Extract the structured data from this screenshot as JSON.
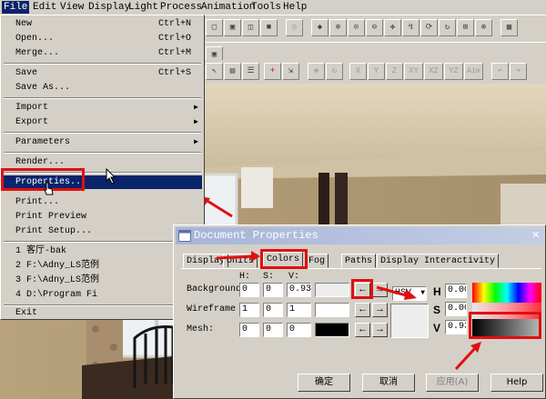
{
  "menubar": {
    "items": [
      "File",
      "Edit",
      "View",
      "Display",
      "Light",
      "Process",
      "Animation",
      "Tools",
      "Help"
    ]
  },
  "toolbar": {
    "axis_buttons": [
      "X",
      "Y",
      "Z",
      "XY",
      "XZ",
      "YZ",
      "Aim"
    ]
  },
  "file_menu": {
    "items": [
      {
        "label": "New",
        "shortcut": "Ctrl+N"
      },
      {
        "label": "Open...",
        "shortcut": "Ctrl+O"
      },
      {
        "label": "Merge...",
        "shortcut": "Ctrl+M"
      },
      {
        "label": "Save",
        "shortcut": "Ctrl+S"
      },
      {
        "label": "Save As..."
      },
      {
        "label": "Import"
      },
      {
        "label": "Export"
      },
      {
        "label": "Parameters"
      },
      {
        "label": "Render..."
      },
      {
        "label": "Properties..."
      },
      {
        "label": "Print..."
      },
      {
        "label": "Print Preview"
      },
      {
        "label": "Print Setup..."
      },
      {
        "label": "1 客厅-bak"
      },
      {
        "label": "2 F:\\Adny_LS范例"
      },
      {
        "label": "3 F:\\Adny_LS范例"
      },
      {
        "label": "4 D:\\Program Fi"
      },
      {
        "label": "Exit"
      }
    ]
  },
  "dialog": {
    "title": "Document Properties",
    "close_glyph": "×",
    "tabs": [
      "Display",
      "Units",
      "Colors",
      "Fog",
      "Paths",
      "Display Interactivity"
    ],
    "headers": {
      "h": "H:",
      "s": "S:",
      "v": "V:"
    },
    "rows": [
      {
        "label": "Background:",
        "h": "0",
        "s": "0",
        "v": "0.93"
      },
      {
        "label": "Wireframe",
        "h": "1",
        "s": "0",
        "v": "1"
      },
      {
        "label": "Mesh:",
        "h": "0",
        "s": "0",
        "v": "0"
      }
    ],
    "mode_select": "HSV",
    "hsv_labels": {
      "h": "H",
      "s": "S",
      "v": "V"
    },
    "hsv_values": {
      "h": "0.00",
      "s": "0.00",
      "v": "0.93"
    },
    "buttons": {
      "ok": "确定",
      "cancel": "取消",
      "apply": "应用(A)",
      "help": "Help"
    }
  },
  "colors": {
    "highlight": "#0a246a",
    "annotation_red": "#e01010",
    "background_swatch": "#ededed",
    "wireframe_swatch": "#ffffff",
    "mesh_swatch": "#000000"
  }
}
